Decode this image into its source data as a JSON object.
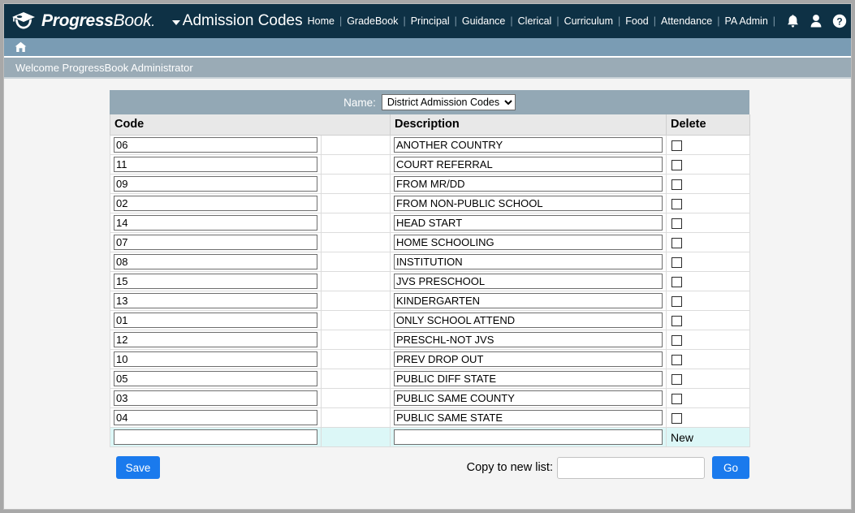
{
  "header": {
    "brand_bold": "Progress",
    "brand_light": "Book",
    "brand_dot": ".",
    "module_title": "Admission Codes",
    "logo_icon": "graduation-cap-logo-icon",
    "caret_icon": "caret-down-icon",
    "nav_items": [
      "Home",
      "GradeBook",
      "Principal",
      "Guidance",
      "Clerical",
      "Curriculum",
      "Food",
      "Attendance",
      "PA Admin"
    ],
    "icons": {
      "bell": "bell-icon",
      "user": "user-icon",
      "help": "help-icon"
    },
    "bg_color": "#0e3145"
  },
  "crumbbar": {
    "home_icon": "home-icon",
    "bg_color": "#7a9cb4"
  },
  "welcome": {
    "text": "Welcome ProgressBook Administrator",
    "bg_color": "#9aabb6"
  },
  "panel": {
    "name_label": "Name:",
    "name_selected": "District Admission Codes",
    "name_options": [
      "District Admission Codes"
    ],
    "columns": {
      "code": "Code",
      "gap": "",
      "description": "Description",
      "delete": "Delete"
    },
    "rows": [
      {
        "code": "06",
        "description": "ANOTHER COUNTRY",
        "delete_checked": false
      },
      {
        "code": "11",
        "description": "COURT REFERRAL",
        "delete_checked": false
      },
      {
        "code": "09",
        "description": "FROM MR/DD",
        "delete_checked": false
      },
      {
        "code": "02",
        "description": "FROM NON-PUBLIC SCHOOL",
        "delete_checked": false
      },
      {
        "code": "14",
        "description": "HEAD START",
        "delete_checked": false
      },
      {
        "code": "07",
        "description": "HOME SCHOOLING",
        "delete_checked": false
      },
      {
        "code": "08",
        "description": "INSTITUTION",
        "delete_checked": false
      },
      {
        "code": "15",
        "description": "JVS PRESCHOOL",
        "delete_checked": false
      },
      {
        "code": "13",
        "description": "KINDERGARTEN",
        "delete_checked": false
      },
      {
        "code": "01",
        "description": "ONLY SCHOOL ATTEND",
        "delete_checked": false
      },
      {
        "code": "12",
        "description": "PRESCHL-NOT JVS",
        "delete_checked": false
      },
      {
        "code": "10",
        "description": "PREV DROP OUT",
        "delete_checked": false
      },
      {
        "code": "05",
        "description": "PUBLIC DIFF STATE",
        "delete_checked": false
      },
      {
        "code": "03",
        "description": "PUBLIC SAME COUNTY",
        "delete_checked": false
      },
      {
        "code": "04",
        "description": "PUBLIC SAME STATE",
        "delete_checked": false
      }
    ],
    "new_row": {
      "code": "",
      "description": "",
      "label": "New"
    }
  },
  "footer": {
    "save_label": "Save",
    "copy_label": "Copy to new list:",
    "copy_value": "",
    "go_label": "Go",
    "button_color": "#1a7aed"
  }
}
